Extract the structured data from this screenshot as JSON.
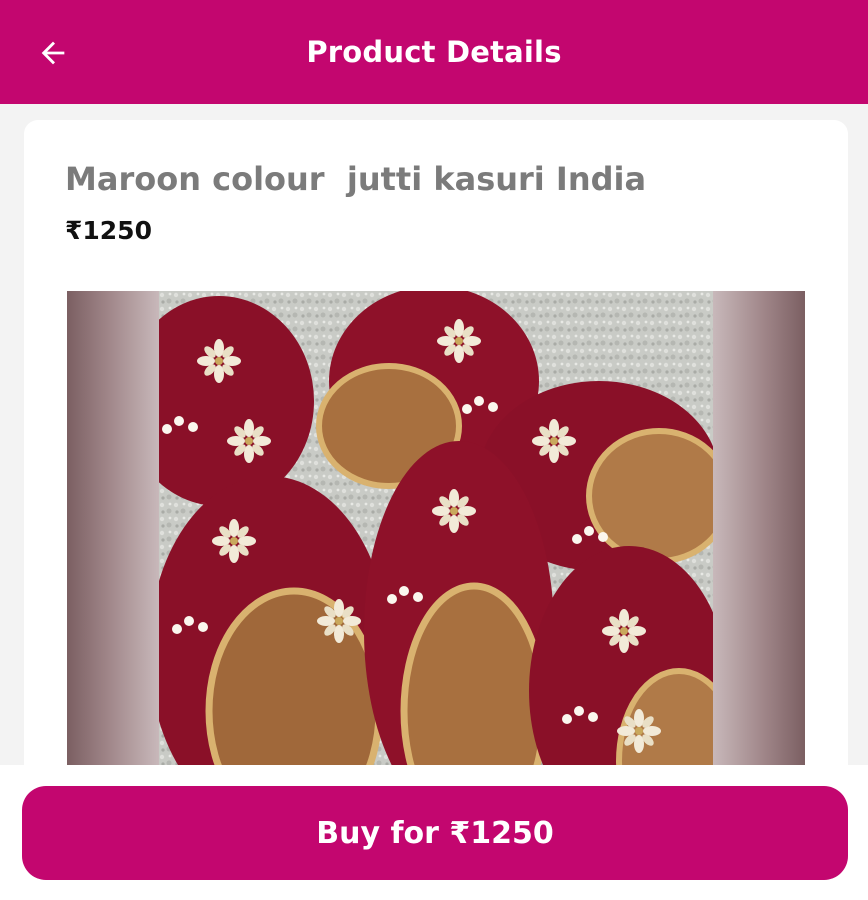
{
  "header": {
    "title": "Product Details",
    "back_icon": "arrow-left-icon"
  },
  "product": {
    "title": "Maroon colour  jutti kasuri India",
    "price": "₹1250",
    "image_icon": "product-photo-jutti"
  },
  "actions": {
    "buy_prefix": "Buy for ",
    "buy_price": "₹1250"
  },
  "colors": {
    "brand": "#c3066f",
    "title_text": "#7b7b7b",
    "price_text": "#111111",
    "background": "#f3f3f3"
  }
}
